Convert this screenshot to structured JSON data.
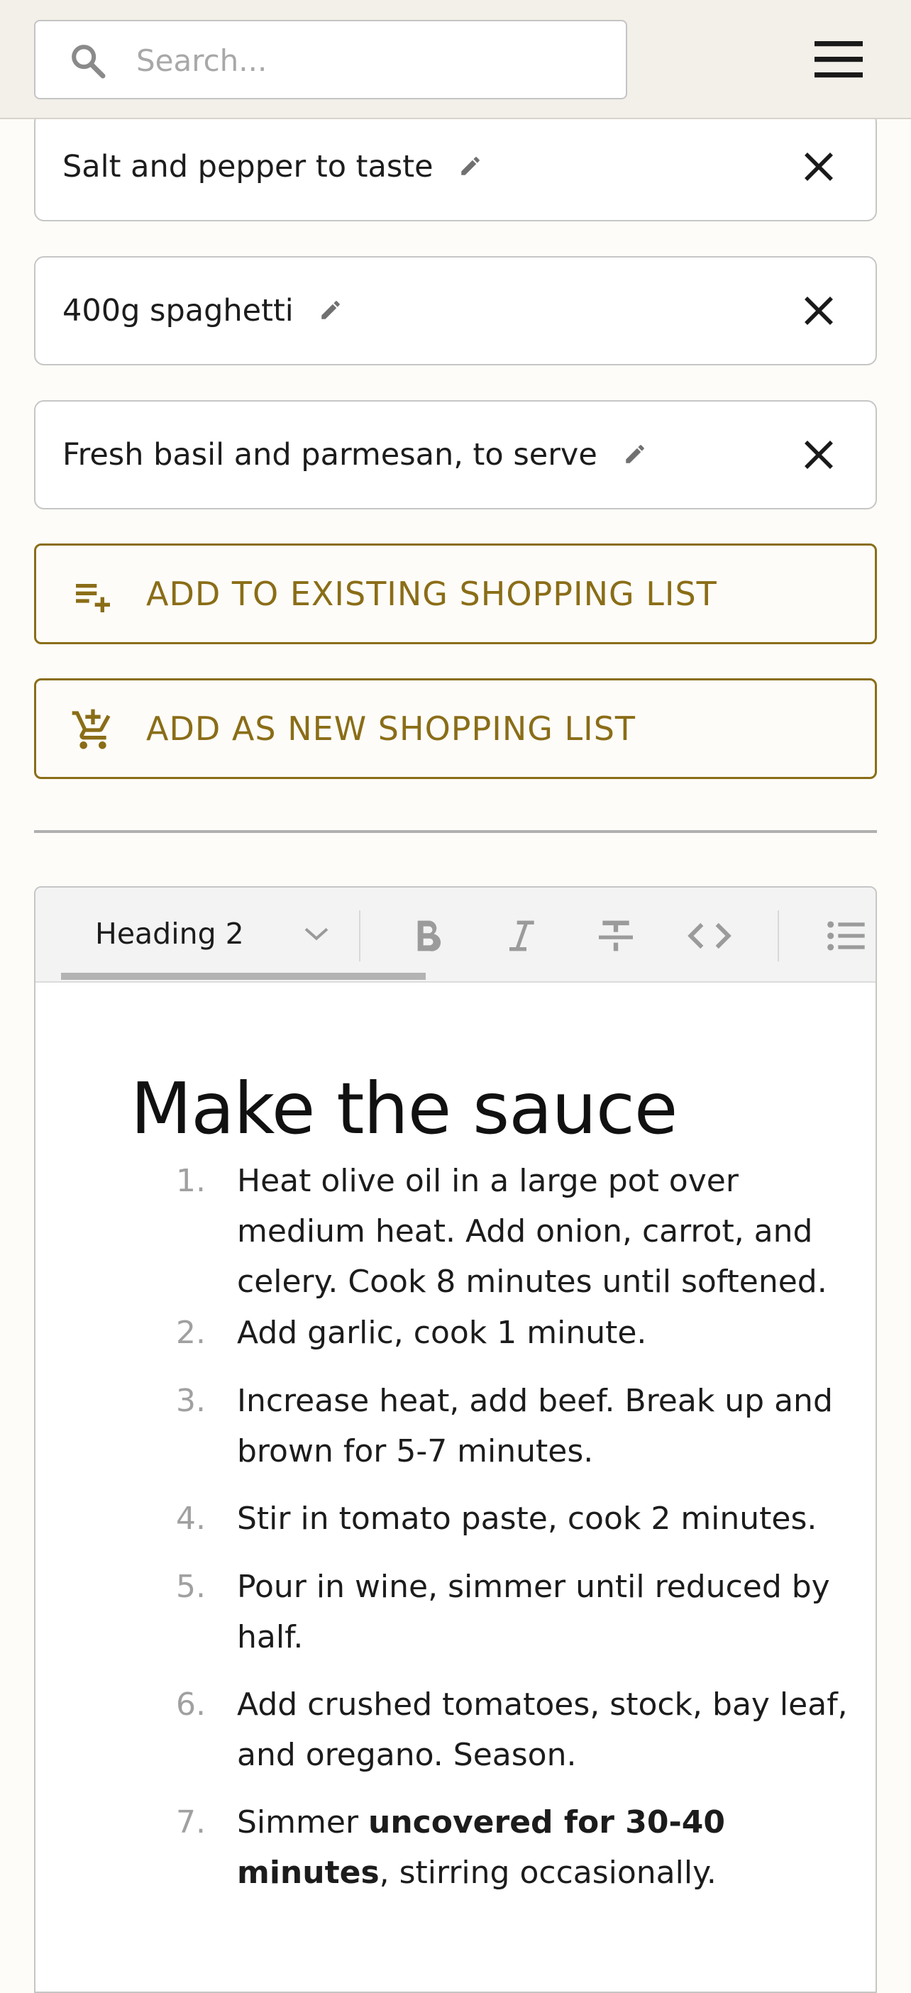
{
  "search": {
    "placeholder": "Search..."
  },
  "ingredients": [
    {
      "label": "Salt and pepper to taste"
    },
    {
      "label": "400g spaghetti"
    },
    {
      "label": "Fresh basil and parmesan, to serve"
    }
  ],
  "actions": {
    "add_existing": "ADD TO EXISTING SHOPPING LIST",
    "add_new": "ADD AS NEW SHOPPING LIST"
  },
  "colors": {
    "accent": "#8a6d17",
    "topbar": "#f3f0e9",
    "page": "#fdfcf8"
  },
  "editor": {
    "block_type": "Heading 2",
    "toolbar_icons": [
      "bold-icon",
      "italic-icon",
      "strikethrough-icon",
      "code-icon",
      "bullet-list-icon"
    ],
    "heading": "Make the sauce",
    "steps": [
      {
        "num": "1.",
        "text": "Heat olive oil in a large pot over medium heat. Add onion, carrot, and celery. Cook 8 minutes until softened."
      },
      {
        "num": "2.",
        "text": "Add garlic, cook 1 minute."
      },
      {
        "num": "3.",
        "text": "Increase heat, add beef. Break up and brown for 5-7 minutes."
      },
      {
        "num": "4.",
        "text": "Stir in tomato paste, cook 2 minutes."
      },
      {
        "num": "5.",
        "text": "Pour in wine, simmer until reduced by half."
      },
      {
        "num": "6.",
        "text": "Add crushed tomatoes, stock, bay leaf, and oregano. Season."
      },
      {
        "num": "7.",
        "pre": "Simmer ",
        "bold": "uncovered for 30-40 minutes",
        "post": ", stirring occasionally."
      }
    ]
  }
}
